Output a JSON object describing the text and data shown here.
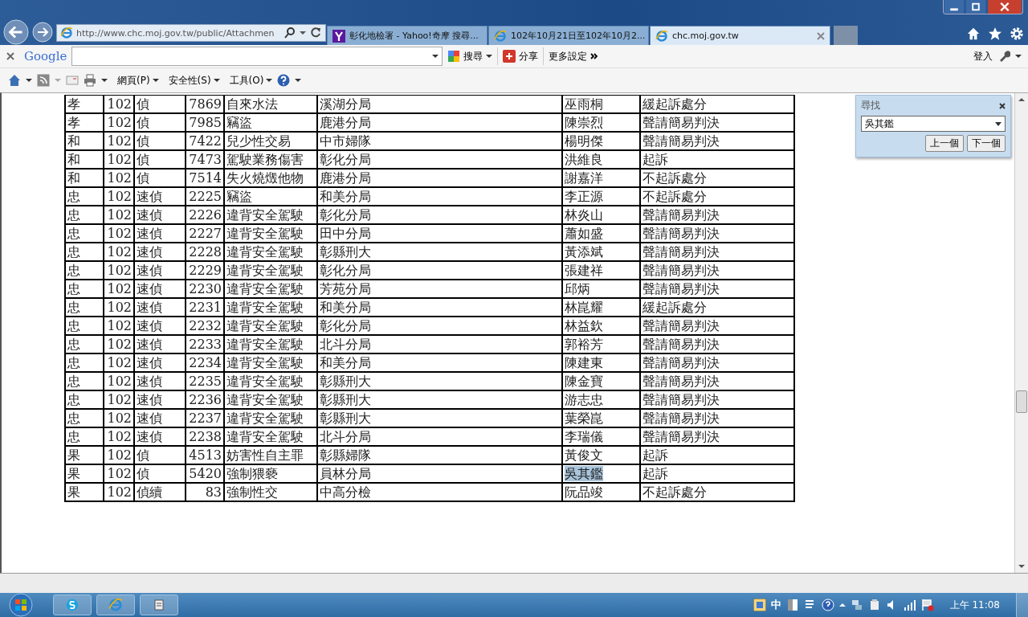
{
  "browser": {
    "address": "http://www.chc.moj.gov.tw/public/Attachmen",
    "tabs": [
      {
        "title": "彰化地檢署 - Yahoo!奇摩 搜尋...",
        "kind": "yahoo",
        "selected": false
      },
      {
        "title": "102年10月21日至102年10月2...",
        "kind": "ie",
        "selected": false
      },
      {
        "title": "chc.moj.gov.tw",
        "kind": "ie",
        "selected": true
      }
    ]
  },
  "google_toolbar": {
    "logo": "Google",
    "search_button": "搜尋",
    "share_button": "分享",
    "more_settings": "更多設定",
    "sign_in": "登入"
  },
  "command_bar": [
    "網頁(P)",
    "安全性(S)",
    "工具(O)"
  ],
  "table": {
    "rows": [
      {
        "cells": [
          "孝",
          "102",
          "偵",
          "7869",
          "自來水法",
          "溪湖分局",
          "巫雨桐",
          "緩起訴處分"
        ],
        "highlighted": false
      },
      {
        "cells": [
          "孝",
          "102",
          "偵",
          "7985",
          "竊盜",
          "鹿港分局",
          "陳崇烈",
          "聲請簡易判決"
        ],
        "highlighted": false
      },
      {
        "cells": [
          "和",
          "102",
          "偵",
          "7422",
          "兒少性交易",
          "中市婦隊",
          "楊明傑",
          "聲請簡易判決"
        ],
        "highlighted": false
      },
      {
        "cells": [
          "和",
          "102",
          "偵",
          "7473",
          "駕駛業務傷害",
          "彰化分局",
          "洪維良",
          "起訴"
        ],
        "highlighted": false
      },
      {
        "cells": [
          "和",
          "102",
          "偵",
          "7514",
          "失火燒燬他物",
          "鹿港分局",
          "謝嘉洋",
          "不起訴處分"
        ],
        "highlighted": false
      },
      {
        "cells": [
          "忠",
          "102",
          "速偵",
          "2225",
          "竊盜",
          "和美分局",
          "李正源",
          "不起訴處分"
        ],
        "highlighted": false
      },
      {
        "cells": [
          "忠",
          "102",
          "速偵",
          "2226",
          "違背安全駕駛",
          "彰化分局",
          "林炎山",
          "聲請簡易判決"
        ],
        "highlighted": false
      },
      {
        "cells": [
          "忠",
          "102",
          "速偵",
          "2227",
          "違背安全駕駛",
          "田中分局",
          "蕭如盛",
          "聲請簡易判決"
        ],
        "highlighted": false
      },
      {
        "cells": [
          "忠",
          "102",
          "速偵",
          "2228",
          "違背安全駕駛",
          "彰縣刑大",
          "黃添斌",
          "聲請簡易判決"
        ],
        "highlighted": false
      },
      {
        "cells": [
          "忠",
          "102",
          "速偵",
          "2229",
          "違背安全駕駛",
          "彰化分局",
          "張建祥",
          "聲請簡易判決"
        ],
        "highlighted": false
      },
      {
        "cells": [
          "忠",
          "102",
          "速偵",
          "2230",
          "違背安全駕駛",
          "芳苑分局",
          "邱炳",
          "聲請簡易判決"
        ],
        "highlighted": false
      },
      {
        "cells": [
          "忠",
          "102",
          "速偵",
          "2231",
          "違背安全駕駛",
          "和美分局",
          "林崑耀",
          "緩起訴處分"
        ],
        "highlighted": false
      },
      {
        "cells": [
          "忠",
          "102",
          "速偵",
          "2232",
          "違背安全駕駛",
          "彰化分局",
          "林益欽",
          "聲請簡易判決"
        ],
        "highlighted": false
      },
      {
        "cells": [
          "忠",
          "102",
          "速偵",
          "2233",
          "違背安全駕駛",
          "北斗分局",
          "郭裕芳",
          "聲請簡易判決"
        ],
        "highlighted": false
      },
      {
        "cells": [
          "忠",
          "102",
          "速偵",
          "2234",
          "違背安全駕駛",
          "和美分局",
          "陳建東",
          "聲請簡易判決"
        ],
        "highlighted": false
      },
      {
        "cells": [
          "忠",
          "102",
          "速偵",
          "2235",
          "違背安全駕駛",
          "彰縣刑大",
          "陳金寶",
          "聲請簡易判決"
        ],
        "highlighted": false
      },
      {
        "cells": [
          "忠",
          "102",
          "速偵",
          "2236",
          "違背安全駕駛",
          "彰縣刑大",
          "游志忠",
          "聲請簡易判決"
        ],
        "highlighted": false
      },
      {
        "cells": [
          "忠",
          "102",
          "速偵",
          "2237",
          "違背安全駕駛",
          "彰縣刑大",
          "葉榮崑",
          "聲請簡易判決"
        ],
        "highlighted": false
      },
      {
        "cells": [
          "忠",
          "102",
          "速偵",
          "2238",
          "違背安全駕駛",
          "北斗分局",
          "李瑞儀",
          "聲請簡易判決"
        ],
        "highlighted": false
      },
      {
        "cells": [
          "果",
          "102",
          "偵",
          "4513",
          "妨害性自主罪",
          "彰縣婦隊",
          "黃俊文",
          "起訴"
        ],
        "highlighted": false
      },
      {
        "cells": [
          "果",
          "102",
          "偵",
          "5420",
          "強制猥褻",
          "員林分局",
          "吳其鑑",
          "起訴"
        ],
        "highlighted": true
      },
      {
        "cells": [
          "果",
          "102",
          "偵續",
          "83",
          "強制性交",
          "中高分檢",
          "阮品竣",
          "不起訴處分"
        ],
        "highlighted": false
      }
    ]
  },
  "find_panel": {
    "title": "尋找",
    "query": "吳其鑑",
    "previous_button": "上一個",
    "next_button": "下一個"
  },
  "taskbar": {
    "ime": "中",
    "clock": "上午 11:08"
  }
}
